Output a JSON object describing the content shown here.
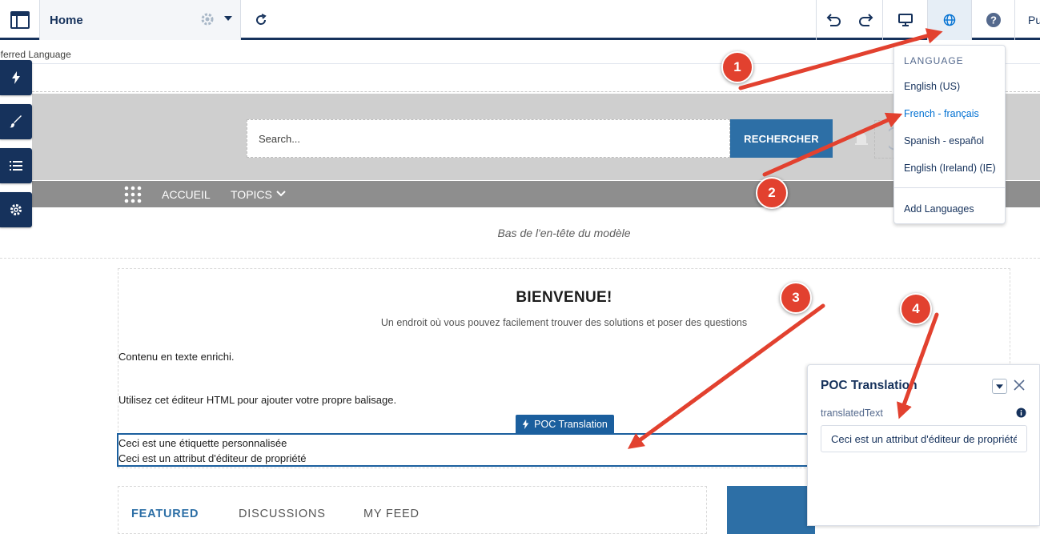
{
  "toolbar": {
    "page_title": "Home",
    "publish_label": "Pu"
  },
  "preferred_language_label": "eferred Language",
  "header": {
    "search_placeholder": "Search...",
    "search_button": "RECHERCHER",
    "nav": {
      "home": "ACCUEIL",
      "topics": "TOPICS"
    },
    "bottom_label": "Bas de l'en-tête du modèle"
  },
  "content": {
    "welcome_title": "BIENVENUE!",
    "welcome_subtitle": "Un endroit où vous pouvez facilement trouver des solutions et poser des questions",
    "rich_text": "Contenu en texte enrichi.",
    "html_text": "Utilisez cet éditeur HTML pour ajouter votre propre balisage.",
    "component_tag": "POC Translation",
    "custom_label": "Ceci est une étiquette personnalisée",
    "property_attribute": "Ceci est un attribut d'éditeur de propriété"
  },
  "feed_tabs": [
    "FEATURED",
    "DISCUSSIONS",
    "MY FEED"
  ],
  "language_menu": {
    "header": "LANGUAGE",
    "options": [
      "English (US)",
      "French - français",
      "Spanish - español",
      "English (Ireland) (IE)"
    ],
    "selected": "French - français",
    "add_languages": "Add Languages"
  },
  "property_panel": {
    "title": "POC Translation",
    "field_label": "translatedText",
    "field_value": "Ceci est un attribut d'éditeur de propriété"
  },
  "annotations": [
    "1",
    "2",
    "3",
    "4"
  ],
  "colors": {
    "brand_navy": "#16325c",
    "primary_blue": "#2d6fa6",
    "selected_link": "#0070d2",
    "annotation_red": "#e2412f"
  }
}
